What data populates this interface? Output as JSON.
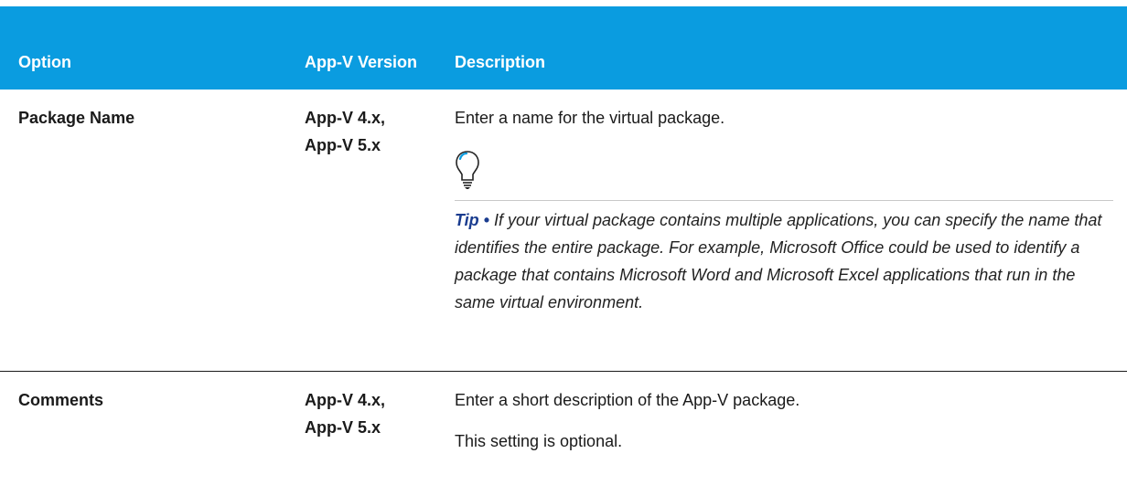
{
  "columns": {
    "option": "Option",
    "version": "App-V Version",
    "description": "Description"
  },
  "rows": [
    {
      "option": "Package Name",
      "version": [
        "App-V 4.x,",
        "App-V 5.x"
      ],
      "description": "Enter a name for the virtual package.",
      "tip": {
        "label": "Tip •",
        "text": "If your virtual package contains multiple applications, you can specify the name that identifies the entire package. For example, Microsoft Office could be used to identify a package that contains Microsoft Word and Microsoft Excel applications that run in the same virtual environment.",
        "icon": "lightbulb-icon"
      }
    },
    {
      "option": "Comments",
      "version": [
        "App-V 4.x,",
        "App-V 5.x"
      ],
      "description": "Enter a short description of the App-V package.",
      "note": "This setting is optional."
    }
  ],
  "colors": {
    "header_bg": "#0a9ce0",
    "header_text": "#ffffff",
    "tip_label": "#1a3c8f"
  }
}
